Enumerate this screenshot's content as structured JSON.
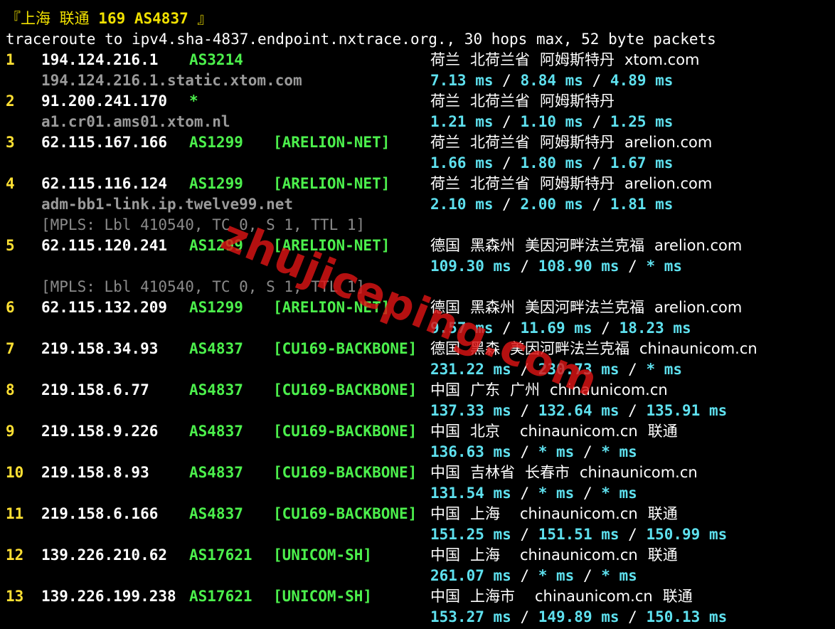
{
  "header": {
    "open_bracket": "『",
    "city": "上海 联通 ",
    "label": "169 AS4837",
    "close_bracket": " 』"
  },
  "command_line": "traceroute to ipv4.sha-4837.endpoint.nxtrace.org., 30 hops max, 52 byte packets",
  "rows": [
    {
      "hop": "1",
      "ip": "194.124.216.1",
      "as": "AS3214",
      "tag": "",
      "geo": [
        "荷兰",
        "北荷兰省",
        "阿姆斯特丹",
        "xtom.com"
      ],
      "host": "194.124.216.1.static.xtom.com",
      "rtt": [
        "7.13 ms",
        "8.84 ms",
        "4.89 ms"
      ]
    },
    {
      "hop": "2",
      "ip": "91.200.241.170",
      "as": "*",
      "tag": "",
      "geo": [
        "荷兰",
        "北荷兰省",
        "阿姆斯特丹"
      ],
      "host": "a1.cr01.ams01.xtom.nl",
      "rtt": [
        "1.21 ms",
        "1.10 ms",
        "1.25 ms"
      ]
    },
    {
      "hop": "3",
      "ip": "62.115.167.166",
      "as": "AS1299",
      "tag": "[ARELION-NET]",
      "geo": [
        "荷兰",
        "北荷兰省",
        "阿姆斯特丹",
        "arelion.com"
      ],
      "host": "",
      "rtt": [
        "1.66 ms",
        "1.80 ms",
        "1.67 ms"
      ]
    },
    {
      "hop": "4",
      "ip": "62.115.116.124",
      "as": "AS1299",
      "tag": "[ARELION-NET]",
      "geo": [
        "荷兰",
        "北荷兰省",
        "阿姆斯特丹",
        "arelion.com"
      ],
      "host": "adm-bb1-link.ip.twelve99.net",
      "rtt": [
        "2.10 ms",
        "2.00 ms",
        "1.81 ms"
      ],
      "mpls": "[MPLS: Lbl 410540, TC 0, S 1, TTL 1]"
    },
    {
      "hop": "5",
      "ip": "62.115.120.241",
      "as": "AS1299",
      "tag": "[ARELION-NET]",
      "geo": [
        "德国",
        "黑森州",
        "美因河畔法兰克福",
        "arelion.com"
      ],
      "host": "",
      "rtt": [
        "109.30 ms",
        "108.90 ms",
        "* ms"
      ],
      "mpls": "[MPLS: Lbl 410540, TC 0, S 1, TTL 1]"
    },
    {
      "hop": "6",
      "ip": "62.115.132.209",
      "as": "AS1299",
      "tag": "[ARELION-NET]",
      "geo": [
        "德国",
        "黑森州",
        "美因河畔法兰克福",
        "arelion.com"
      ],
      "host": "",
      "rtt": [
        "9.57 ms",
        "11.69 ms",
        "18.23 ms"
      ]
    },
    {
      "hop": "7",
      "ip": "219.158.34.93",
      "as": "AS4837",
      "tag": "[CU169-BACKBONE]",
      "geo": [
        "德国",
        "黑森",
        "美因河畔法兰克福",
        "chinaunicom.cn"
      ],
      "host": "",
      "rtt": [
        "231.22 ms",
        "230.73 ms",
        "* ms"
      ]
    },
    {
      "hop": "8",
      "ip": "219.158.6.77",
      "as": "AS4837",
      "tag": "[CU169-BACKBONE]",
      "geo": [
        "中国",
        "广东",
        "广州",
        "chinaunicom.cn"
      ],
      "host": "",
      "rtt": [
        "137.33 ms",
        "132.64 ms",
        "135.91 ms"
      ]
    },
    {
      "hop": "9",
      "ip": "219.158.9.226",
      "as": "AS4837",
      "tag": "[CU169-BACKBONE]",
      "geo": [
        "中国",
        "北京",
        "",
        "chinaunicom.cn",
        "联通"
      ],
      "host": "",
      "rtt": [
        "136.63 ms",
        "* ms",
        "* ms"
      ]
    },
    {
      "hop": "10",
      "ip": "219.158.8.93",
      "as": "AS4837",
      "tag": "[CU169-BACKBONE]",
      "geo": [
        "中国",
        "吉林省",
        "长春市",
        "chinaunicom.cn"
      ],
      "host": "",
      "rtt": [
        "131.54 ms",
        "* ms",
        "* ms"
      ]
    },
    {
      "hop": "11",
      "ip": "219.158.6.166",
      "as": "AS4837",
      "tag": "[CU169-BACKBONE]",
      "geo": [
        "中国",
        "上海",
        "",
        "chinaunicom.cn",
        "联通"
      ],
      "host": "",
      "rtt": [
        "151.25 ms",
        "151.51 ms",
        "150.99 ms"
      ]
    },
    {
      "hop": "12",
      "ip": "139.226.210.62",
      "as": "AS17621",
      "tag": "[UNICOM-SH]",
      "geo": [
        "中国",
        "上海",
        "",
        "chinaunicom.cn",
        "联通"
      ],
      "host": "",
      "rtt": [
        "261.07 ms",
        "* ms",
        "* ms"
      ]
    },
    {
      "hop": "13",
      "ip": "139.226.199.238",
      "as": "AS17621",
      "tag": "[UNICOM-SH]",
      "geo": [
        "中国",
        "上海市",
        "",
        "chinaunicom.cn",
        "联通"
      ],
      "host": "",
      "rtt": [
        "153.27 ms",
        "149.89 ms",
        "150.13 ms"
      ]
    }
  ],
  "watermark": "zhujiceping.com",
  "colors": {
    "background": "#000000",
    "hop_number": "#ffe033",
    "asn": "#4cf04c",
    "rtt": "#5ee0ee",
    "hostname": "#9a9a9a",
    "header": "#f0e000",
    "watermark": "#dc1414"
  }
}
